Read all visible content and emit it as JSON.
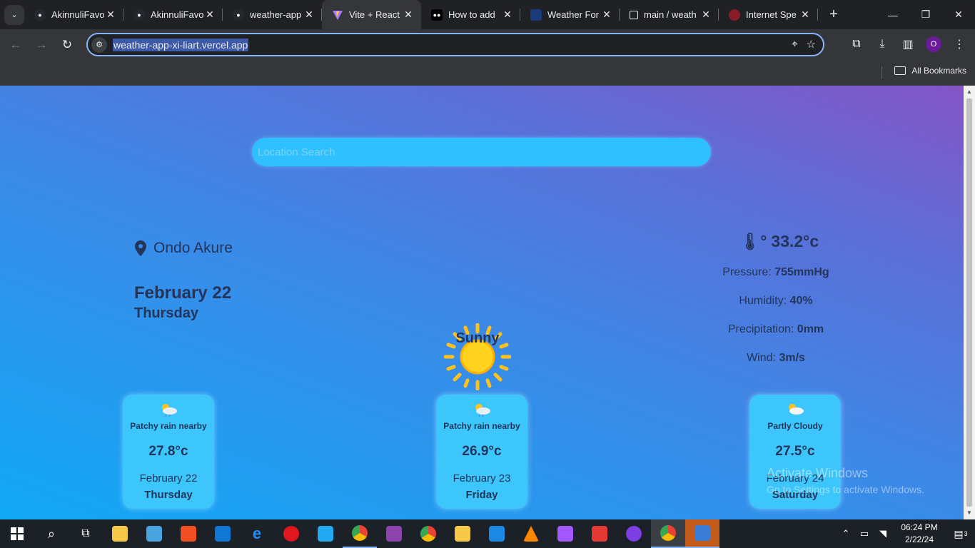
{
  "browser": {
    "tabs": [
      {
        "title": "AkinnuliFavo",
        "favicon": "github-icon"
      },
      {
        "title": "AkinnuliFavo",
        "favicon": "github-icon"
      },
      {
        "title": "weather-app",
        "favicon": "github-icon"
      },
      {
        "title": "Vite + React",
        "favicon": "vite-icon",
        "active": true
      },
      {
        "title": "How to add",
        "favicon": "medium-icon"
      },
      {
        "title": "Weather For",
        "favicon": "weather-site-icon"
      },
      {
        "title": "main / weath",
        "favicon": "vercel-icon"
      },
      {
        "title": "Internet Spe",
        "favicon": "speedtest-icon"
      }
    ],
    "url": "weather-app-xi-liart.vercel.app",
    "profile_initial": "O",
    "bookmarks_label": "All Bookmarks"
  },
  "app": {
    "search_placeholder": "Location Search",
    "location": "Ondo Akure",
    "date": "February 22",
    "day": "Thursday",
    "condition": "Sunny",
    "temperature": "33.2°c",
    "stats": {
      "pressure_label": "Pressure:",
      "pressure_value": "755mmHg",
      "humidity_label": "Humidity:",
      "humidity_value": "40%",
      "precip_label": "Precipitation:",
      "precip_value": "0mm",
      "wind_label": "Wind:",
      "wind_value": "3m/s"
    },
    "forecast": [
      {
        "condition": "Patchy rain nearby",
        "temp": "27.8°c",
        "date": "February 22",
        "day": "Thursday",
        "icon": "patchy-rain-icon"
      },
      {
        "condition": "Patchy rain nearby",
        "temp": "26.9°c",
        "date": "February 23",
        "day": "Friday",
        "icon": "patchy-rain-icon"
      },
      {
        "condition": "Partly Cloudy",
        "temp": "27.5°c",
        "date": "February 24",
        "day": "Saturday",
        "icon": "partly-cloudy-icon"
      }
    ]
  },
  "os": {
    "watermark_title": "Activate Windows",
    "watermark_sub": "Go to Settings to activate Windows.",
    "time": "06:24 PM",
    "date": "2/22/24",
    "notifications": "3"
  }
}
